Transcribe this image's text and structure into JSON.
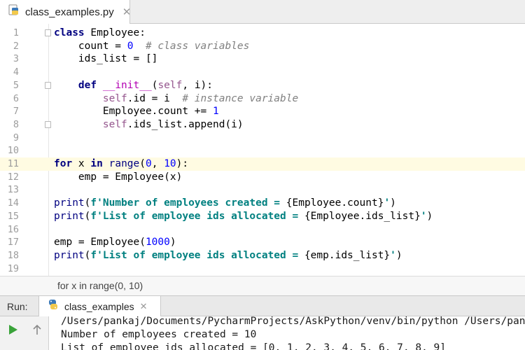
{
  "tab": {
    "filename": "class_examples.py",
    "icon": "python-file-icon",
    "close": "✕"
  },
  "editor": {
    "lines": [
      {
        "n": "1",
        "fold": true,
        "current": false,
        "tokens": [
          [
            "kw",
            "class"
          ],
          [
            "",
            " Employee:"
          ]
        ]
      },
      {
        "n": "2",
        "fold": false,
        "current": false,
        "tokens": [
          [
            "",
            "    count = "
          ],
          [
            "num",
            "0"
          ],
          [
            "",
            "  "
          ],
          [
            "cmt",
            "# class variables"
          ]
        ]
      },
      {
        "n": "3",
        "fold": false,
        "current": false,
        "tokens": [
          [
            "",
            "    ids_list = []"
          ]
        ]
      },
      {
        "n": "4",
        "fold": false,
        "current": false,
        "tokens": []
      },
      {
        "n": "5",
        "fold": true,
        "current": false,
        "tokens": [
          [
            "",
            "    "
          ],
          [
            "kw",
            "def"
          ],
          [
            "",
            " "
          ],
          [
            "fn",
            "__init__"
          ],
          [
            "",
            "("
          ],
          [
            "slf",
            "self"
          ],
          [
            "",
            ", i):"
          ]
        ]
      },
      {
        "n": "6",
        "fold": false,
        "current": false,
        "tokens": [
          [
            "",
            "        "
          ],
          [
            "slf",
            "self"
          ],
          [
            "",
            ".id = i  "
          ],
          [
            "cmt",
            "# instance variable"
          ]
        ]
      },
      {
        "n": "7",
        "fold": false,
        "current": false,
        "tokens": [
          [
            "",
            "        Employee.count += "
          ],
          [
            "num",
            "1"
          ]
        ]
      },
      {
        "n": "8",
        "fold": true,
        "current": false,
        "tokens": [
          [
            "",
            "        "
          ],
          [
            "slf",
            "self"
          ],
          [
            "",
            ".ids_list.append(i)"
          ]
        ]
      },
      {
        "n": "9",
        "fold": false,
        "current": false,
        "tokens": []
      },
      {
        "n": "10",
        "fold": false,
        "current": false,
        "tokens": []
      },
      {
        "n": "11",
        "fold": false,
        "current": true,
        "tokens": [
          [
            "kw",
            "for"
          ],
          [
            "",
            " x "
          ],
          [
            "kw",
            "in"
          ],
          [
            "",
            " "
          ],
          [
            "bi",
            "range"
          ],
          [
            "",
            "("
          ],
          [
            "num",
            "0"
          ],
          [
            "",
            ", "
          ],
          [
            "num",
            "10"
          ],
          [
            "",
            "):"
          ]
        ]
      },
      {
        "n": "12",
        "fold": false,
        "current": false,
        "tokens": [
          [
            "",
            "    emp = Employee(x)"
          ]
        ]
      },
      {
        "n": "13",
        "fold": false,
        "current": false,
        "tokens": []
      },
      {
        "n": "14",
        "fold": false,
        "current": false,
        "tokens": [
          [
            "bi",
            "print"
          ],
          [
            "",
            "("
          ],
          [
            "str",
            "f'Number of employees created = "
          ],
          [
            "",
            "{Employee.count}"
          ],
          [
            "str",
            "'"
          ],
          [
            "",
            ")"
          ]
        ]
      },
      {
        "n": "15",
        "fold": false,
        "current": false,
        "tokens": [
          [
            "bi",
            "print"
          ],
          [
            "",
            "("
          ],
          [
            "str",
            "f'List of employee ids allocated = "
          ],
          [
            "",
            "{Employee.ids_list}"
          ],
          [
            "str",
            "'"
          ],
          [
            "",
            ")"
          ]
        ]
      },
      {
        "n": "16",
        "fold": false,
        "current": false,
        "tokens": []
      },
      {
        "n": "17",
        "fold": false,
        "current": false,
        "tokens": [
          [
            "",
            "emp = Employee("
          ],
          [
            "num",
            "1000"
          ],
          [
            "",
            ")"
          ]
        ]
      },
      {
        "n": "18",
        "fold": false,
        "current": false,
        "tokens": [
          [
            "bi",
            "print"
          ],
          [
            "",
            "("
          ],
          [
            "str",
            "f'List of employee ids allocated = "
          ],
          [
            "",
            "{emp.ids_list}"
          ],
          [
            "str",
            "'"
          ],
          [
            "",
            ")"
          ]
        ]
      },
      {
        "n": "19",
        "fold": false,
        "current": false,
        "tokens": []
      }
    ]
  },
  "breadcrumb": {
    "text": "for x in range(0, 10)"
  },
  "run": {
    "title": "Run:",
    "tab_label": "class_examples",
    "tab_icon": "python-icon",
    "close": "✕",
    "tools": [
      {
        "name": "run-button",
        "icon": "play-icon",
        "color": "#3aa33a"
      },
      {
        "name": "scroll-up-button",
        "icon": "up-arrow-icon",
        "color": "#8a8a8a"
      }
    ],
    "console": [
      "/Users/pankaj/Documents/PycharmProjects/AskPython/venv/bin/python /Users/pank",
      "Number of employees created = 10",
      "List of employee ids allocated = [0, 1, 2, 3, 4, 5, 6, 7, 8, 9]"
    ]
  },
  "colors": {
    "keyword": "#000080",
    "number": "#0000ff",
    "comment": "#808080",
    "self": "#94558d",
    "string": "#008080",
    "current_line": "#fffbe2"
  }
}
